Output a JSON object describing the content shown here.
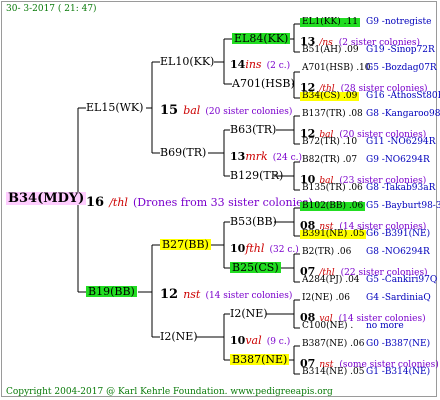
{
  "header": {
    "date": "30- 3-2017 ( 21: 47)"
  },
  "root": {
    "id": "B34(MDY)"
  },
  "gen1": {
    "number": "16",
    "name": "/thl",
    "drones": "(Drones from 33 sister colonies)",
    "mother": "EL15(WK)",
    "father": "B19(BB)"
  },
  "l2a": {
    "number": "15",
    "name": "bal",
    "sister": "(20 sister colonies)",
    "top": "EL10(KK)",
    "bottom": "B69(TR)"
  },
  "l2b": {
    "number": "12",
    "name": "nst",
    "sister": "(14 sister colonies)",
    "top": "B27(BB)",
    "bottom": "I2(NE)"
  },
  "l3a": {
    "number": "14",
    "name": "ins",
    "sister": "(2 c.)",
    "top": "EL84(KK)",
    "bottom": "A701(HSB)"
  },
  "l3b": {
    "number": "13",
    "name": "mrk",
    "sister": "(24 c.)",
    "top": "B63(TR)",
    "bottom": "B129(TR)"
  },
  "l3c": {
    "number": "10",
    "name": "fthl",
    "sister": "(32 c.)",
    "top": "B53(BB)",
    "bottom": "B25(CS)"
  },
  "l3d": {
    "number": "10",
    "name": "val",
    "sister": "(9 c.)",
    "top": "I2(NE)",
    "bottom": "B387(NE)"
  },
  "right": [
    {
      "top": "EL1(KK) .11",
      "top_code": "G9 -notregiste",
      "num": "13",
      "name": "/ns",
      "sister": "(2 sister colonies)",
      "bottom": "B51(AH) .09",
      "bottom_code": "G19 -Sinop72R"
    },
    {
      "top": "A701(HSB) .10",
      "top_code": "G5 -Bozdag07R",
      "num": "12",
      "name": "/thl",
      "sister": "(28 sister colonies)",
      "bottom": "B34(CS) .09",
      "bottom_code": "G16 -AthosSt80R"
    },
    {
      "top": "B137(TR) .08",
      "top_code": "G8 -Kangaroo98R",
      "num": "12",
      "name": "bal",
      "sister": "(20 sister colonies)",
      "bottom": "B72(TR) .10",
      "bottom_code": "G11 -NO6294R"
    },
    {
      "top": "B82(TR) .07",
      "top_code": "G9 -NO6294R",
      "num": "10",
      "name": "bal",
      "sister": "(23 sister colonies)",
      "bottom": "B135(TR) .06",
      "bottom_code": "G8 -Takab93aR"
    },
    {
      "top": "B102(BB) .06",
      "top_code": "G5 -Bayburt98-3",
      "num": "08",
      "name": "nst",
      "sister": "(14 sister colonies)",
      "bottom": "B391(NE) .05",
      "bottom_code": "G6 -B391(NE)"
    },
    {
      "top": "B2(TR) .06",
      "top_code": "G8 -NO6294R",
      "num": "07",
      "name": "/thl",
      "sister": "(22 sister colonies)",
      "bottom": "A284(PJ) .04",
      "bottom_code": "G5 -Cankiri97Q"
    },
    {
      "top": "I2(NE) .06",
      "top_code": "G4 -SardiniaQ",
      "num": "08",
      "name": "val",
      "sister": "(14 sister colonies)",
      "bottom": "C100(NE) .",
      "bottom_code": "no more"
    },
    {
      "top": "B387(NE) .06",
      "top_code": "G0 -B387(NE)",
      "num": "07",
      "name": "nst",
      "sister": "(some sister colonies)",
      "bottom": "B314(NE) .05",
      "bottom_code": "G1 -B314(NE)"
    }
  ],
  "footer": {
    "copyright": "Copyright 2004-2017 @ Karl Kehrle Foundation.",
    "url": "www.pedigreeapis.org"
  }
}
